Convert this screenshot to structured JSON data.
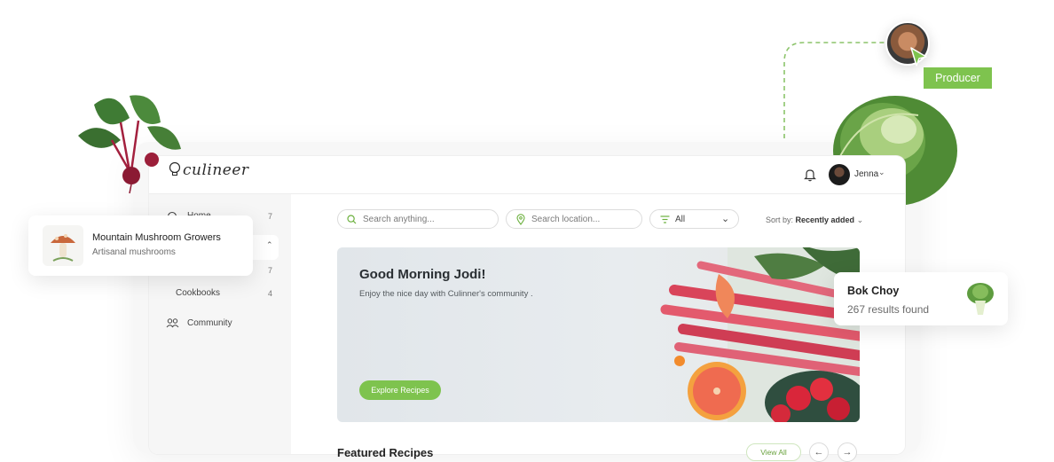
{
  "app": {
    "logo": "culineer",
    "user": {
      "name": "Jenna"
    }
  },
  "sidebar": {
    "items": [
      {
        "label": "Home",
        "count": "7"
      },
      {
        "label": "",
        "count": "7"
      },
      {
        "label": "Cookbooks",
        "count": "4"
      },
      {
        "label": "Community",
        "count": ""
      }
    ]
  },
  "toolbar": {
    "search_placeholder": "Search anything...",
    "location_placeholder": "Search location...",
    "filter_value": "All",
    "sort_label": "Sort by:",
    "sort_value": "Recently added"
  },
  "hero": {
    "title": "Good Morning Jodi!",
    "subtitle": "Enjoy the nice day with Culinner's community .",
    "button": "Explore Recipes"
  },
  "featured": {
    "title": "Featured Recipes",
    "view_all": "View All"
  },
  "floating": {
    "producer_card": {
      "title": "Mountain Mushroom Growers",
      "subtitle": "Artisanal mushrooms"
    },
    "search_card": {
      "title": "Bok Choy",
      "subtitle": "267 results found"
    },
    "producer_tag": "Producer"
  },
  "colors": {
    "accent": "#7ec34e",
    "text": "#1f2328"
  }
}
